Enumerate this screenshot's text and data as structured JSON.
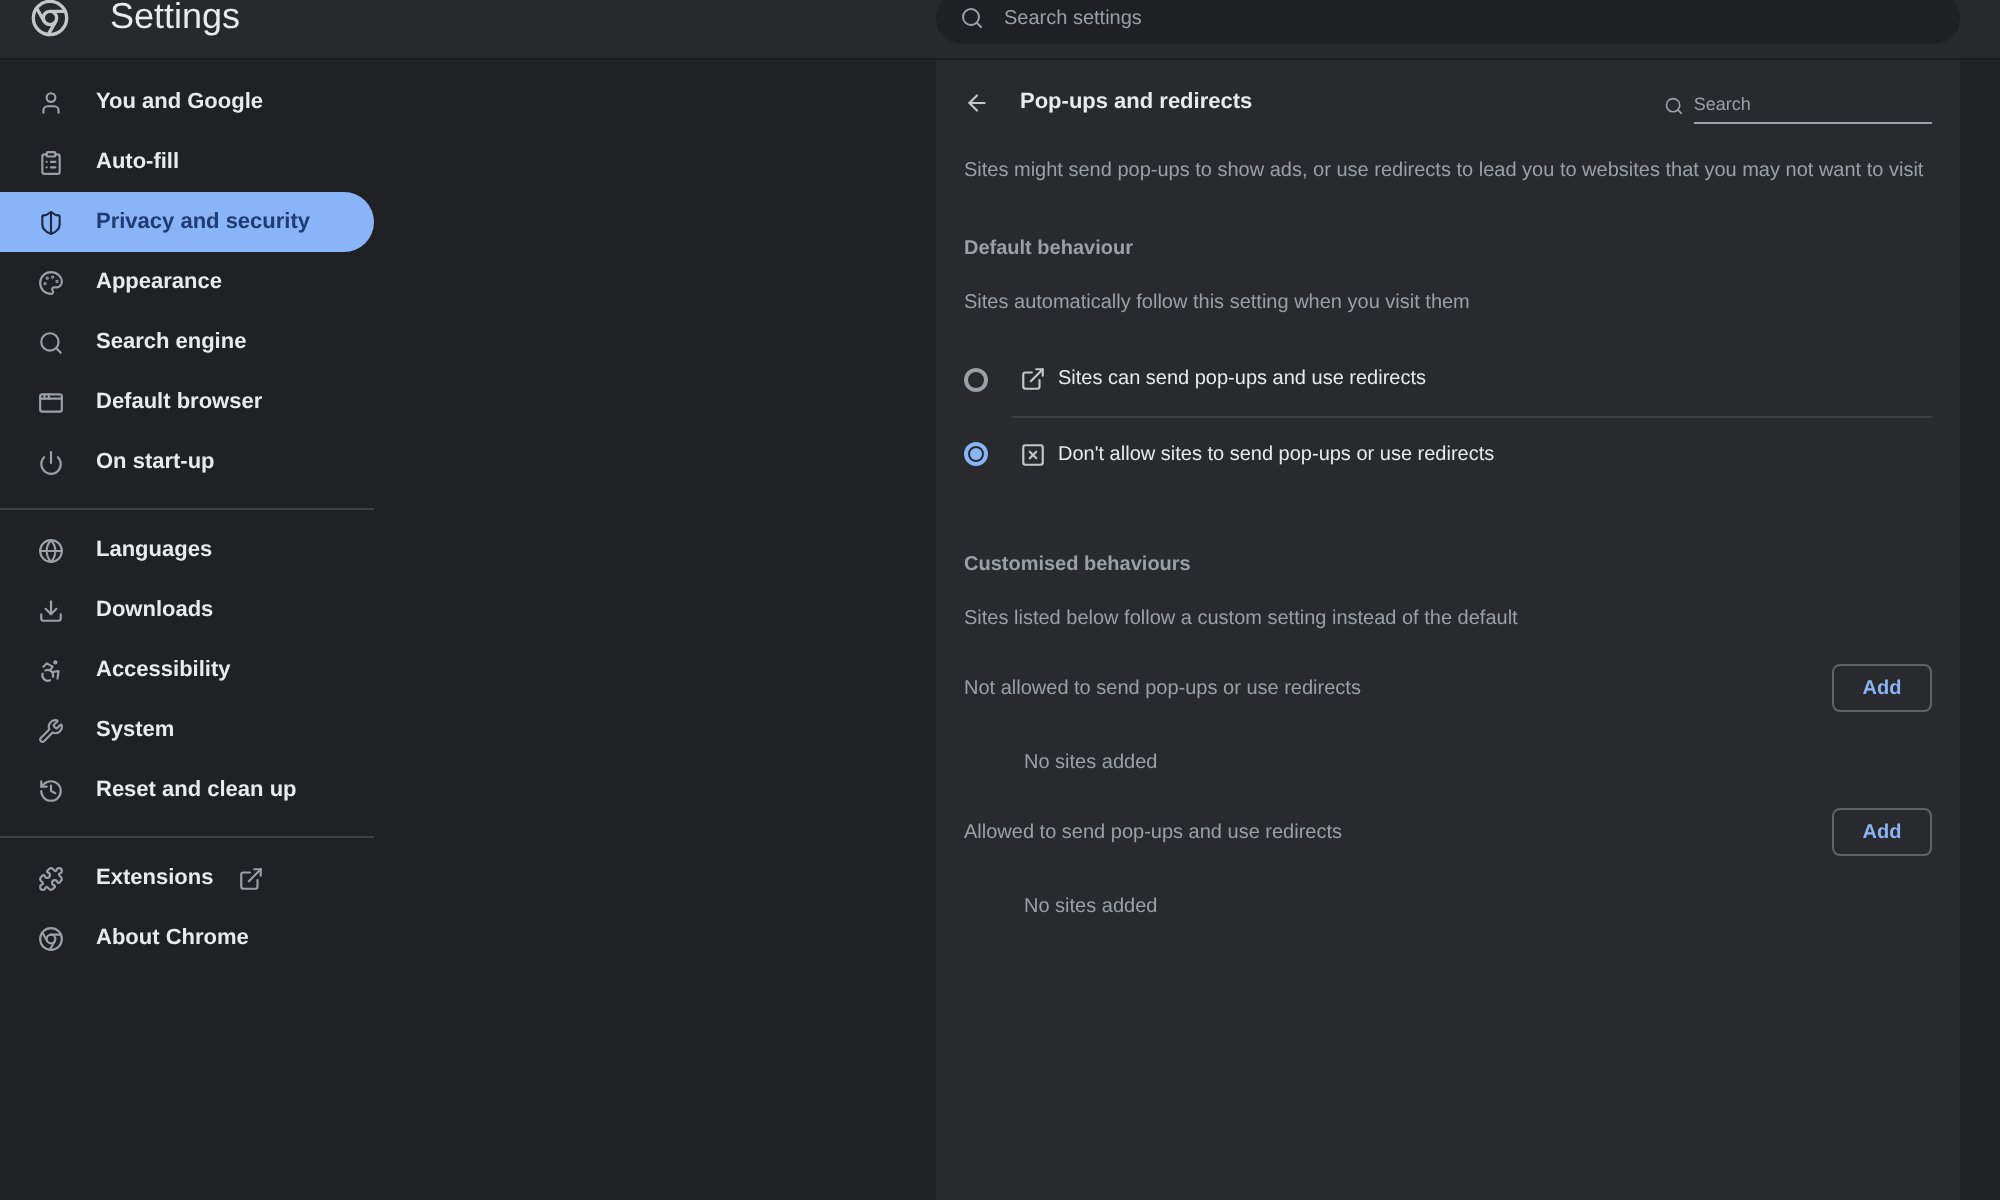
{
  "header": {
    "title": "Settings",
    "search_placeholder": "Search settings"
  },
  "sidebar": {
    "groups": [
      {
        "items": [
          {
            "label": "You and Google",
            "selected": false
          },
          {
            "label": "Auto-fill",
            "selected": false
          },
          {
            "label": "Privacy and security",
            "selected": true
          },
          {
            "label": "Appearance",
            "selected": false
          },
          {
            "label": "Search engine",
            "selected": false
          },
          {
            "label": "Default browser",
            "selected": false
          },
          {
            "label": "On start-up",
            "selected": false
          }
        ]
      },
      {
        "items": [
          {
            "label": "Languages",
            "selected": false
          },
          {
            "label": "Downloads",
            "selected": false
          },
          {
            "label": "Accessibility",
            "selected": false
          },
          {
            "label": "System",
            "selected": false
          },
          {
            "label": "Reset and clean up",
            "selected": false
          }
        ]
      },
      {
        "items": [
          {
            "label": "Extensions",
            "selected": false,
            "external_link": true
          },
          {
            "label": "About Chrome",
            "selected": false,
            "external_link": false
          }
        ]
      }
    ]
  },
  "page": {
    "title": "Pop-ups and redirects",
    "search_placeholder": "Search",
    "description": "Sites might send pop-ups to show ads, or use redirects to lead you to websites that you may not want to visit",
    "default_heading": "Default behaviour",
    "default_subtitle": "Sites automatically follow this setting when you visit them",
    "options": [
      {
        "label": "Sites can send pop-ups and use redirects",
        "selected": false
      },
      {
        "label": "Don't allow sites to send pop-ups or use redirects",
        "selected": true
      }
    ],
    "custom_heading": "Customised behaviours",
    "custom_subtitle": "Sites listed below follow a custom setting instead of the default",
    "lists": [
      {
        "title": "Not allowed to send pop-ups or use redirects",
        "button": "Add",
        "empty": "No sites added"
      },
      {
        "title": "Allowed to send pop-ups and use redirects",
        "button": "Add",
        "empty": "No sites added"
      }
    ]
  }
}
